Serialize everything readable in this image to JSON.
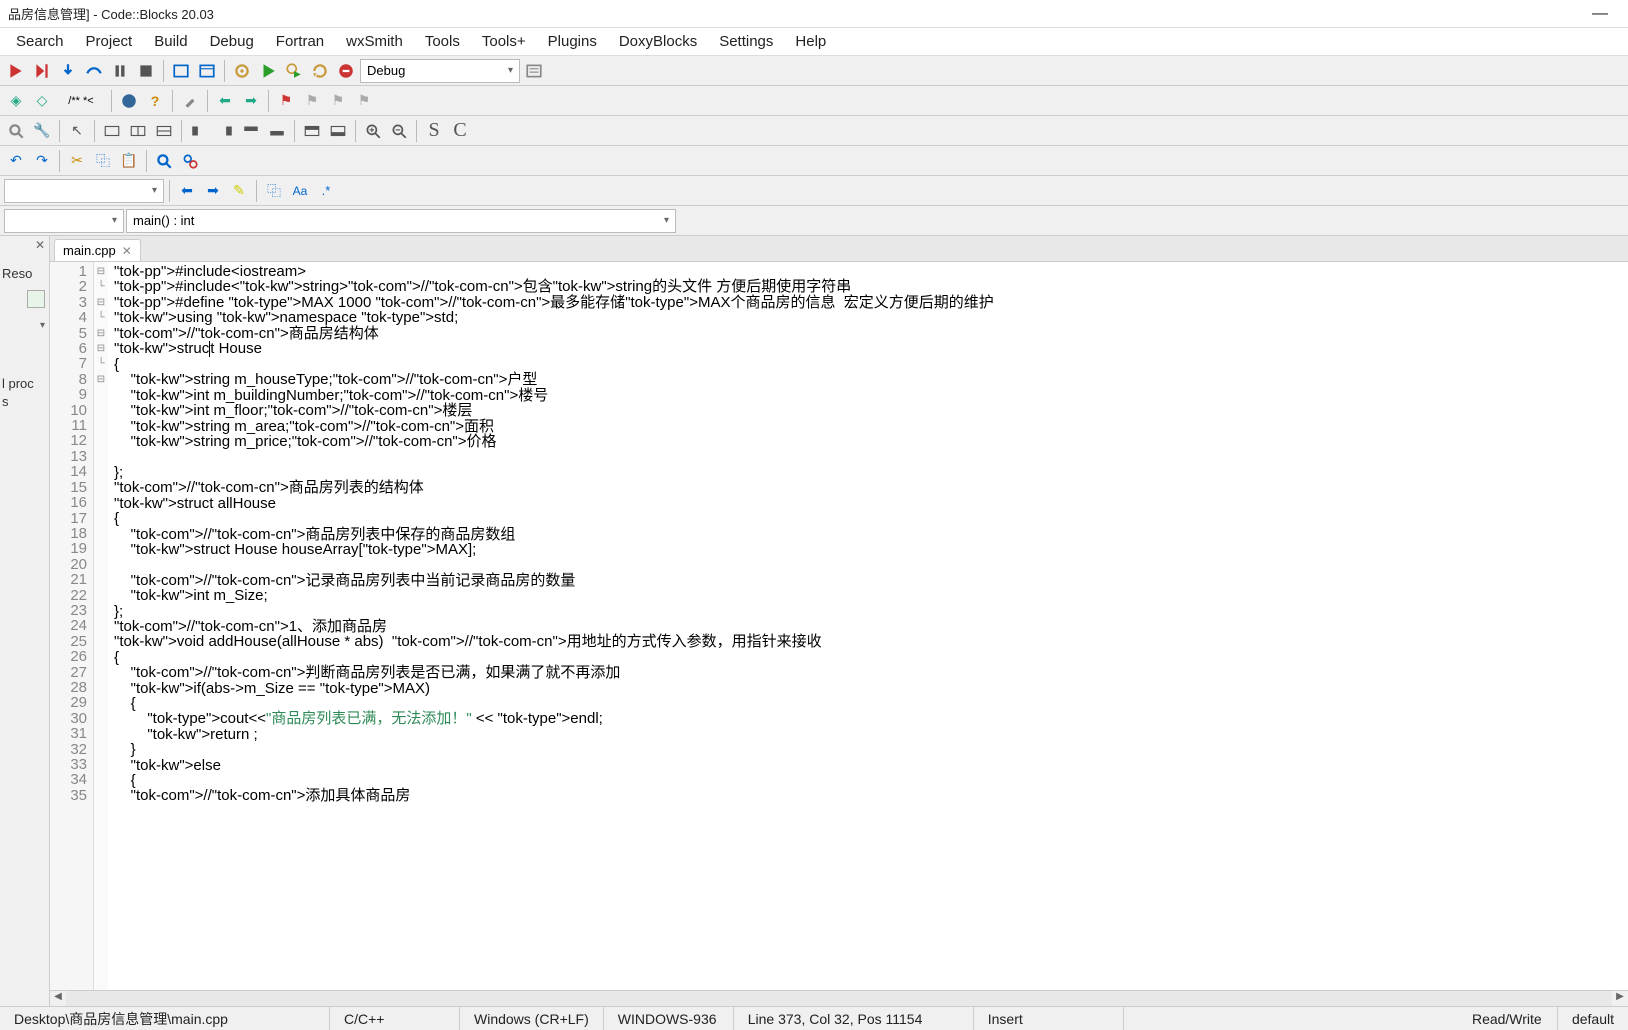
{
  "title": "品房信息管理] - Code::Blocks 20.03",
  "menu": [
    "Search",
    "Project",
    "Build",
    "Debug",
    "Fortran",
    "wxSmith",
    "Tools",
    "Tools+",
    "Plugins",
    "DoxyBlocks",
    "Settings",
    "Help"
  ],
  "build_target": "Debug",
  "comment_token": "/** *<",
  "scope_combo_left": "",
  "scope_combo_right": "main() : int",
  "side": {
    "label1": "Reso",
    "label2": "l proc",
    "label3": "s"
  },
  "tab": {
    "name": "main.cpp"
  },
  "code_lines": {
    "l1": "#include<iostream>",
    "l2": "#include<string>//包含string的头文件 方便后期使用字符串",
    "l3": "#define MAX 1000 //最多能存储MAX个商品房的信息  宏定义方便后期的维护",
    "l4": "using namespace std;",
    "l5": "//商品房结构体",
    "l6": "struct House",
    "l7": "{",
    "l8": "    string m_houseType;//户型",
    "l9": "    int m_buildingNumber;//楼号",
    "l10": "    int m_floor;//楼层",
    "l11": "    string m_area;//面积",
    "l12": "    string m_price;//价格",
    "l13": "",
    "l14": "};",
    "l15": "//商品房列表的结构体",
    "l16": "struct allHouse",
    "l17": "{",
    "l18": "    //商品房列表中保存的商品房数组",
    "l19": "    struct House houseArray[MAX];",
    "l20": "",
    "l21": "    //记录商品房列表中当前记录商品房的数量",
    "l22": "    int m_Size;",
    "l23": "};",
    "l24": "//1、添加商品房",
    "l25": "void addHouse(allHouse * abs)  //用地址的方式传入参数，用指针来接收",
    "l26": "{",
    "l27": "    //判断商品房列表是否已满，如果满了就不再添加",
    "l28": "    if(abs->m_Size == MAX)",
    "l29": "    {",
    "l30": "        cout<<\"商品房列表已满，无法添加！\" << endl;",
    "l31": "        return ;",
    "l32": "    }",
    "l33": "    else",
    "l34": "    {",
    "l35": "    //添加具体商品房"
  },
  "fold": {
    "f7": "⊟",
    "f14": "└",
    "f17": "⊟",
    "f23": "└",
    "f26": "⊟",
    "f29": "⊟",
    "f32": "└",
    "f34": "⊟"
  },
  "status": {
    "path": "Desktop\\商品房信息管理\\main.cpp",
    "lang": "C/C++",
    "eol": "Windows (CR+LF)",
    "encoding": "WINDOWS-936",
    "pos": "Line 373, Col 32, Pos 11154",
    "insert": "Insert",
    "rw": "Read/Write",
    "profile": "default"
  }
}
